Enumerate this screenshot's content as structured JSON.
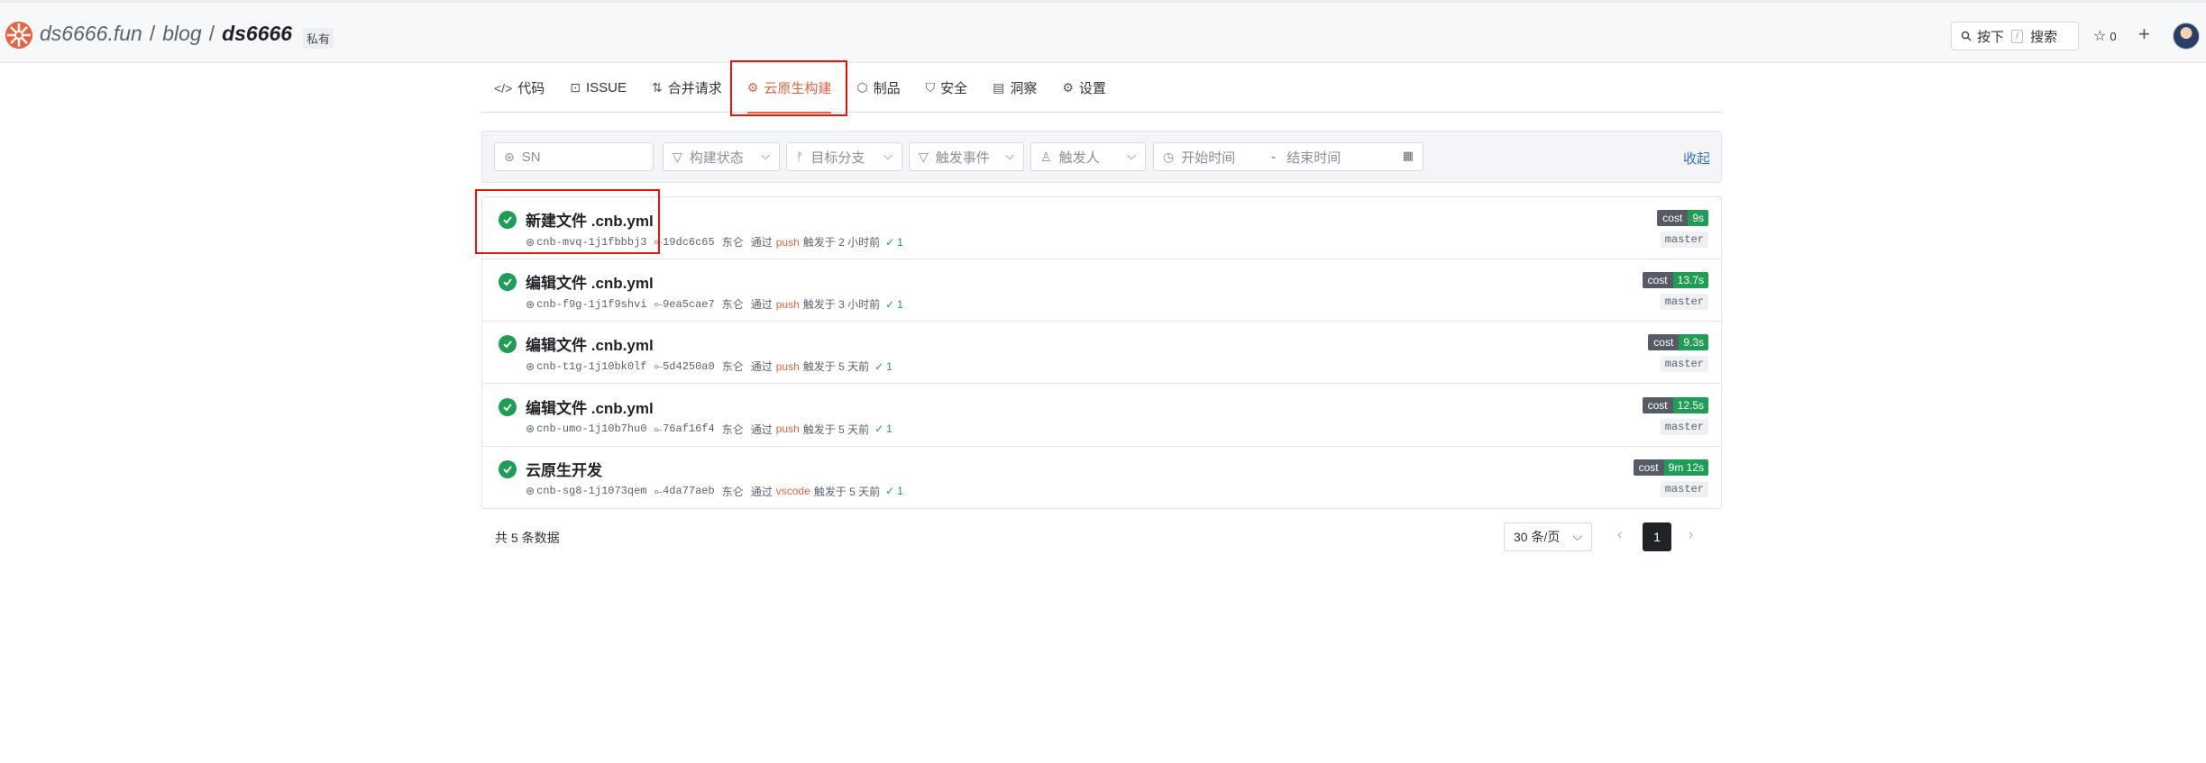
{
  "header": {
    "breadcrumb": [
      "ds6666.fun",
      "blog",
      "ds6666"
    ],
    "separator": "/",
    "visibility": "私有",
    "search": {
      "press": "按下",
      "key": "/",
      "label": "搜索"
    },
    "stars": "0"
  },
  "tabs": [
    {
      "label": "代码",
      "icon": "code-icon"
    },
    {
      "label": "ISSUE",
      "icon": "issue-icon"
    },
    {
      "label": "合并请求",
      "icon": "pull-request-icon"
    },
    {
      "label": "云原生构建",
      "icon": "cloud-build-icon",
      "active": true
    },
    {
      "label": "制品",
      "icon": "package-icon"
    },
    {
      "label": "安全",
      "icon": "shield-icon"
    },
    {
      "label": "洞察",
      "icon": "insights-icon"
    },
    {
      "label": "设置",
      "icon": "gear-icon"
    }
  ],
  "filters": {
    "sn_placeholder": "SN",
    "status": "构建状态",
    "branch": "目标分支",
    "event": "触发事件",
    "trigger_user": "触发人",
    "start_time": "开始时间",
    "range_sep": "-",
    "end_time": "结束时间",
    "collapse": "收起"
  },
  "builds": [
    {
      "title": "新建文件 .cnb.yml",
      "sn": "cnb-mvq-1j1fbbbj3",
      "commit": "19dc6c65",
      "user": "东仑",
      "via": "通过",
      "event": "push",
      "triggered": "触发于 2 小时前",
      "jobs": "1",
      "cost_label": "cost",
      "cost": "9s",
      "branch": "master"
    },
    {
      "title": "编辑文件 .cnb.yml",
      "sn": "cnb-f9g-1j1f9shvi",
      "commit": "9ea5cae7",
      "user": "东仑",
      "via": "通过",
      "event": "push",
      "triggered": "触发于 3 小时前",
      "jobs": "1",
      "cost_label": "cost",
      "cost": "13.7s",
      "branch": "master"
    },
    {
      "title": "编辑文件 .cnb.yml",
      "sn": "cnb-t1g-1j10bk0lf",
      "commit": "5d4250a0",
      "user": "东仑",
      "via": "通过",
      "event": "push",
      "triggered": "触发于 5 天前",
      "jobs": "1",
      "cost_label": "cost",
      "cost": "9.3s",
      "branch": "master"
    },
    {
      "title": "编辑文件 .cnb.yml",
      "sn": "cnb-umo-1j10b7hu0",
      "commit": "76af16f4",
      "user": "东仑",
      "via": "通过",
      "event": "push",
      "triggered": "触发于 5 天前",
      "jobs": "1",
      "cost_label": "cost",
      "cost": "12.5s",
      "branch": "master"
    },
    {
      "title": "云原生开发",
      "sn": "cnb-sg8-1j1073qem",
      "commit": "4da77aeb",
      "user": "东仑",
      "via": "通过",
      "event": "vscode",
      "triggered": "触发于 5 天前",
      "jobs": "1",
      "cost_label": "cost",
      "cost": "9m 12s",
      "branch": "master"
    }
  ],
  "footer": {
    "total": "共 5 条数据",
    "page_size": "30 条/页",
    "current_page": "1"
  },
  "colors": {
    "accent": "#e8623f",
    "success": "#1f9d55",
    "link": "#3373c4"
  }
}
